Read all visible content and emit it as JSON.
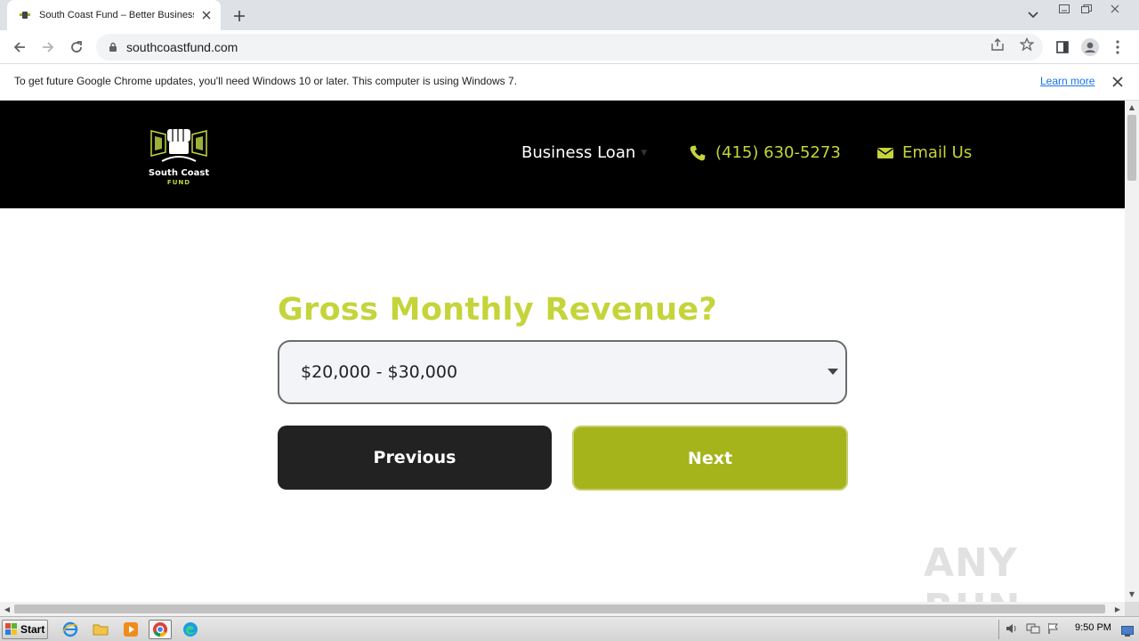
{
  "browser": {
    "tab_title": "South Coast Fund – Better Business",
    "url": "southcoastfund.com"
  },
  "infobar": {
    "message": "To get future Google Chrome updates, you'll need Windows 10 or later. This computer is using Windows 7.",
    "link": "Learn more"
  },
  "site": {
    "logo_line1": "South Coast",
    "logo_line2": "FUND",
    "nav_loan": "Business Loan",
    "nav_phone": "(415) 630-5273",
    "nav_email": "Email Us",
    "accent_color": "#c5d43a",
    "next_color": "#a4b41a"
  },
  "form": {
    "question": "Gross Monthly Revenue?",
    "selected_value": "$20,000 - $30,000",
    "previous_label": "Previous",
    "next_label": "Next"
  },
  "watermark": "ANY RUN",
  "taskbar": {
    "start_label": "Start",
    "clock": "9:50 PM"
  }
}
